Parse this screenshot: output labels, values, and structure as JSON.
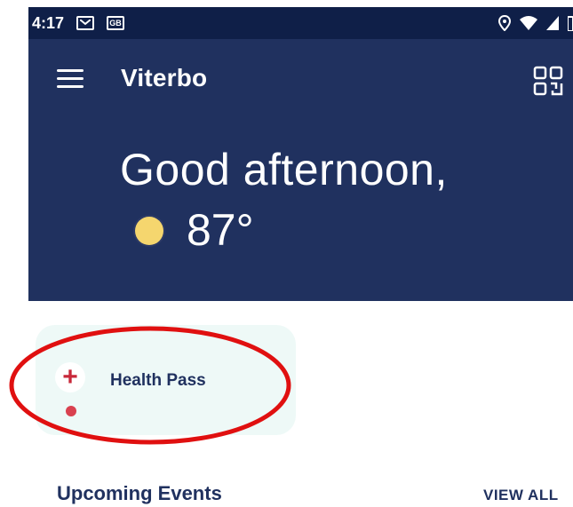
{
  "status_bar": {
    "time": "4:17",
    "icons": [
      "gmail-icon",
      "sim-icon",
      "location-icon",
      "wifi-icon",
      "signal-icon",
      "battery-icon"
    ],
    "sim_label": "GB"
  },
  "header": {
    "title": "Viterbo",
    "greeting": "Good afternoon,",
    "temperature": "87°",
    "background": "#20315f"
  },
  "health_pass": {
    "label": "Health Pass",
    "icon": "plus-icon",
    "icon_color": "#c8283a",
    "card_bg": "#eef9f7"
  },
  "annotation": {
    "shape": "ellipse",
    "color": "#e01010"
  },
  "events": {
    "title": "Upcoming Events",
    "view_all_label": "VIEW ALL"
  }
}
